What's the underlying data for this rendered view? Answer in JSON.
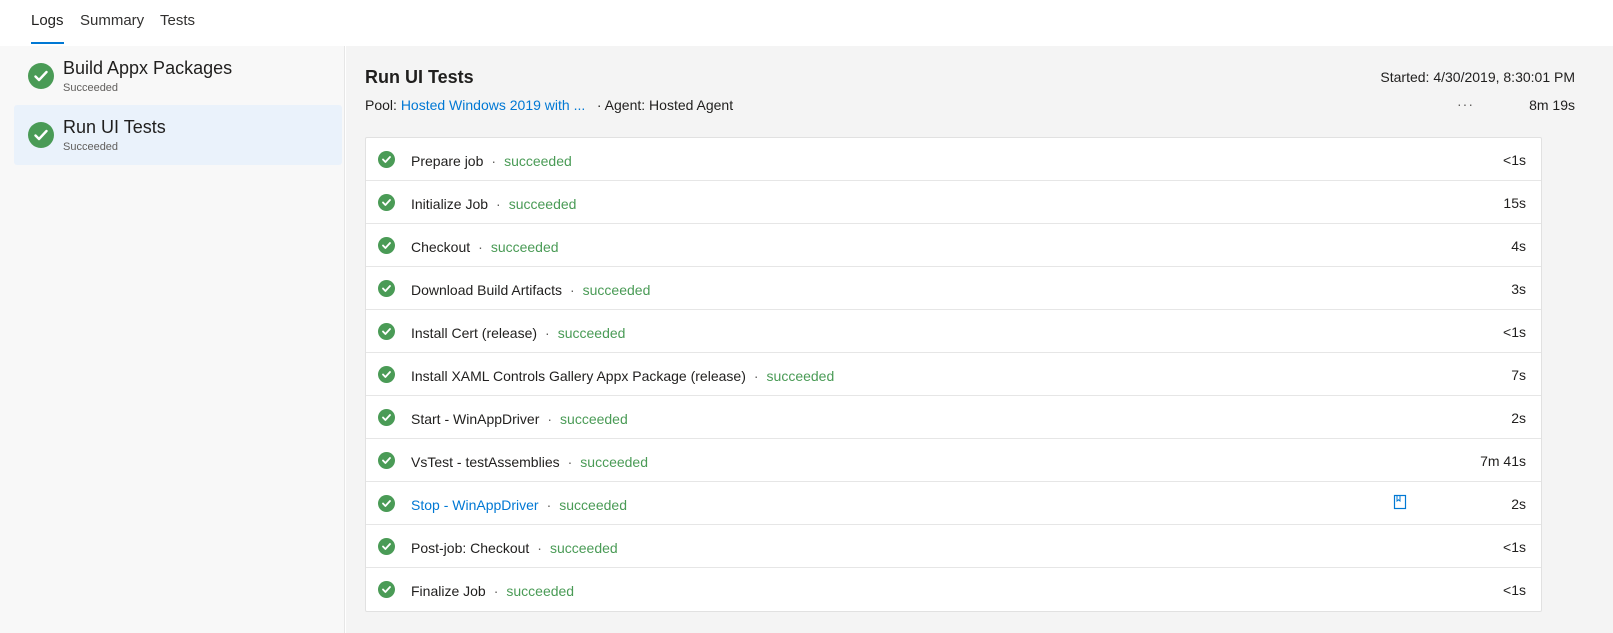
{
  "tabs": [
    {
      "label": "Logs"
    },
    {
      "label": "Summary"
    },
    {
      "label": "Tests"
    }
  ],
  "jobs": [
    {
      "name": "Build Appx Packages",
      "status": "Succeeded"
    },
    {
      "name": "Run UI Tests",
      "status": "Succeeded"
    }
  ],
  "header": {
    "title": "Run UI Tests",
    "started": "Started: 4/30/2019, 8:30:01 PM",
    "pool_label": "Pool:",
    "pool_value": "Hosted Windows 2019 with ...",
    "agent": "· Agent: Hosted Agent",
    "more": "···",
    "duration": "8m 19s"
  },
  "steps": [
    {
      "name": "Prepare job",
      "sep": "·",
      "status": "succeeded",
      "time": "<1s"
    },
    {
      "name": "Initialize Job",
      "sep": "·",
      "status": "succeeded",
      "time": "15s"
    },
    {
      "name": "Checkout",
      "sep": "·",
      "status": "succeeded",
      "time": "4s"
    },
    {
      "name": "Download Build Artifacts",
      "sep": "·",
      "status": "succeeded",
      "time": "3s"
    },
    {
      "name": "Install Cert (release)",
      "sep": "·",
      "status": "succeeded",
      "time": "<1s"
    },
    {
      "name": "Install XAML Controls Gallery Appx Package (release)",
      "sep": "·",
      "status": "succeeded",
      "time": "7s"
    },
    {
      "name": "Start - WinAppDriver",
      "sep": "·",
      "status": "succeeded",
      "time": "2s"
    },
    {
      "name": "VsTest - testAssemblies",
      "sep": "·",
      "status": "succeeded",
      "time": "7m 41s"
    },
    {
      "name": "Stop - WinAppDriver",
      "sep": "·",
      "status": "succeeded",
      "time": "2s"
    },
    {
      "name": "Post-job: Checkout",
      "sep": "·",
      "status": "succeeded",
      "time": "<1s"
    },
    {
      "name": "Finalize Job",
      "sep": "·",
      "status": "succeeded",
      "time": "<1s"
    }
  ],
  "colors": {
    "success": "#4a9b56",
    "link": "#0078d4",
    "selected": "#eaf2fb"
  }
}
